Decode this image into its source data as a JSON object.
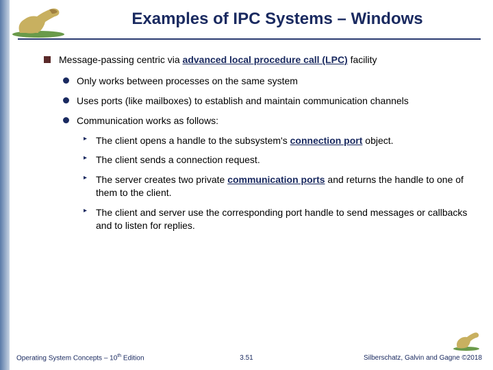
{
  "title": "Examples of IPC Systems – Windows",
  "bullets": {
    "l1_pre": "Message-passing centric via ",
    "l1_term": "advanced local procedure call (LPC)",
    "l1_post": " facility",
    "l2a": "Only works between processes on the same system",
    "l2b": "Uses ports (like mailboxes) to establish and maintain communication channels",
    "l2c": "Communication works as follows:",
    "l3a_pre": "The client opens a handle to the subsystem's ",
    "l3a_term": "connection port",
    "l3a_post": " object.",
    "l3b": "The client sends a connection request.",
    "l3c_pre": "The server creates two private ",
    "l3c_term": "communication ports",
    "l3c_post": " and returns the handle to one of them to the client.",
    "l3d": "The client and server use the corresponding port handle to send messages or callbacks and to listen for replies."
  },
  "footer": {
    "left_pre": "Operating System Concepts – 10",
    "left_sup": "th",
    "left_post": " Edition",
    "center": "3.51",
    "right": "Silberschatz, Galvin and Gagne ©2018"
  }
}
